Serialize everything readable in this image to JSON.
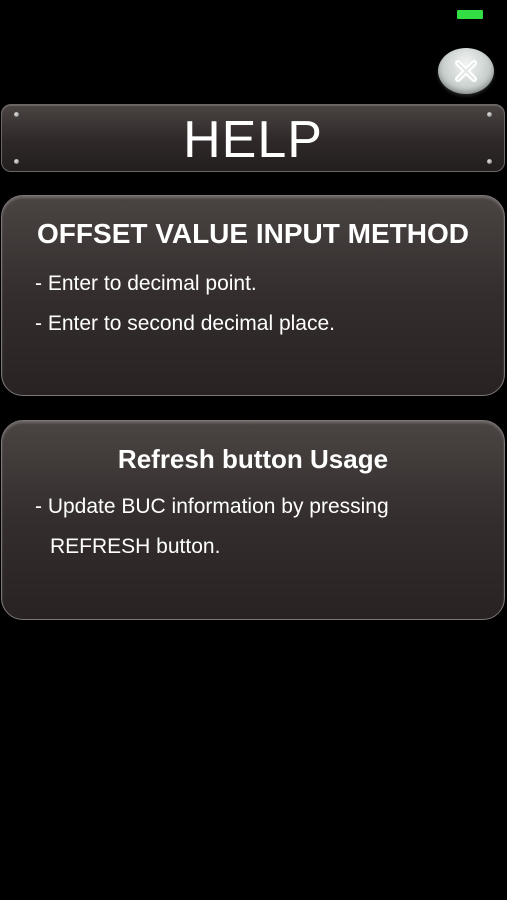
{
  "status_bar": {
    "battery_color": "#33dd44"
  },
  "close_button": {
    "icon": "close-icon"
  },
  "header": {
    "title": "HELP"
  },
  "sections": [
    {
      "heading": "OFFSET VALUE INPUT METHOD",
      "lines": [
        "- Enter to decimal point.",
        "- Enter to second decimal place."
      ]
    },
    {
      "heading": "Refresh button Usage",
      "lines": [
        "- Update BUC information by pressing",
        "REFRESH button."
      ]
    }
  ]
}
